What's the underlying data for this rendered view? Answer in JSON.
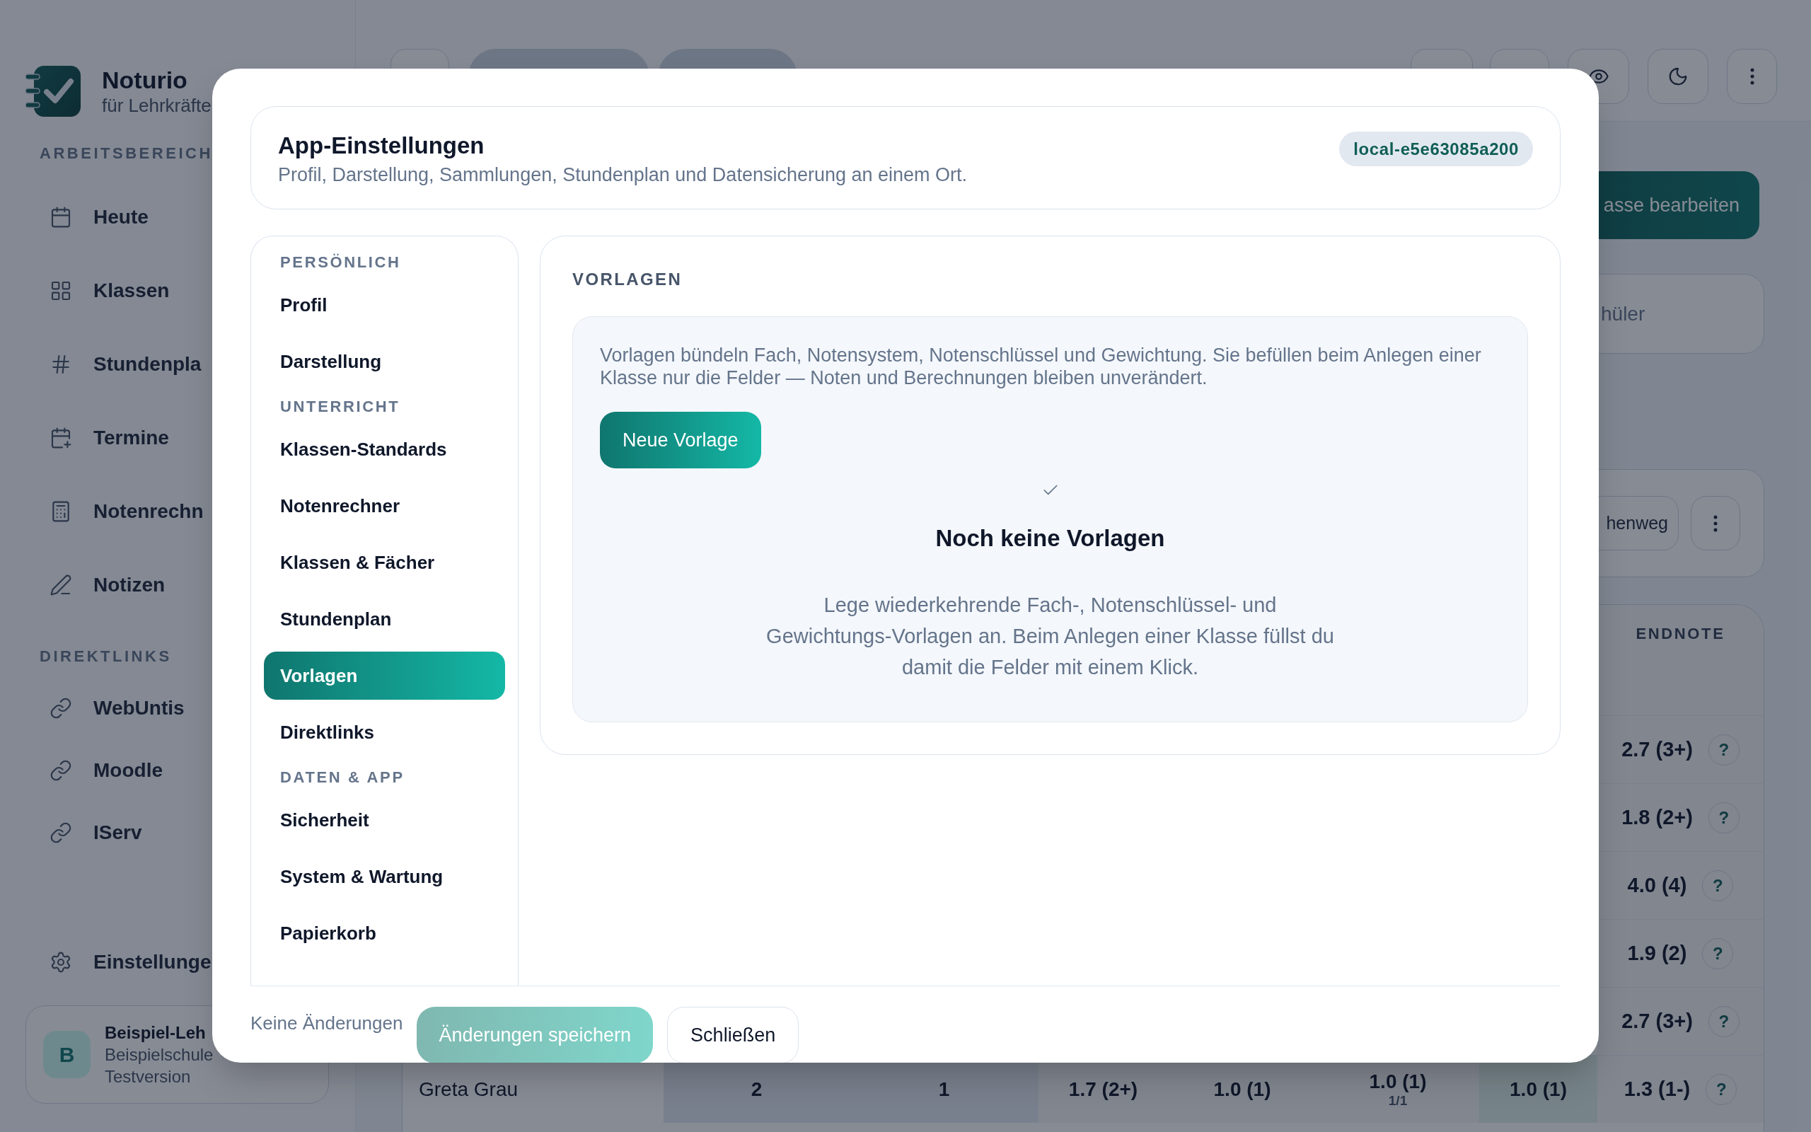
{
  "sidebar": {
    "brand": {
      "name": "Noturio",
      "subtitle": "für Lehrkräfte"
    },
    "sections": [
      {
        "label": "ARBEITSBEREICH",
        "items": [
          "Heute",
          "Klassen",
          "Stundenpla",
          "Termine",
          "Notenrechn",
          "Notizen"
        ]
      },
      {
        "label": "DIREKTLINKS",
        "items": [
          "WebUntis",
          "Moodle",
          "IServ"
        ]
      }
    ],
    "settings": "Einstellunge",
    "profile": {
      "avatar": "B",
      "name": "Beispiel-Leh",
      "school": "Beispielschule",
      "plan": "Testversion"
    }
  },
  "main": {
    "action_button": "asse bearbeiten",
    "partial_card": "hüler",
    "toolbar_button": "henweg",
    "table": {
      "endnote_header": "ENDNOTE",
      "rows": [
        {
          "endnote": "2.7 (3+)",
          "help": "?"
        },
        {
          "endnote": "1.8 (2+)",
          "help": "?"
        },
        {
          "endnote": "4.0 (4)",
          "help": "?"
        },
        {
          "endnote": "1.9 (2)",
          "help": "?"
        },
        {
          "endnote": "2.7 (3+)",
          "help": "?"
        },
        {
          "name": "Greta Grau",
          "cells": [
            {
              "value": "2"
            },
            {
              "value": "1"
            },
            {
              "value": "1.7 (2+)"
            },
            {
              "value": "1.0 (1)"
            },
            {
              "value": "1.0 (1)",
              "sub": "1/1"
            },
            {
              "value": "1.0 (1)"
            }
          ],
          "endnote": "1.3 (1-)",
          "help": "?"
        }
      ]
    }
  },
  "dialog": {
    "title": "App-Einstellungen",
    "subtitle": "Profil, Darstellung, Sammlungen, Stundenplan und Datensicherung an einem Ort.",
    "badge": "local-e5e63085a200",
    "nav": [
      {
        "label": "PERSÖNLICH",
        "items": [
          {
            "label": "Profil",
            "selected": false
          },
          {
            "label": "Darstellung",
            "selected": false
          }
        ]
      },
      {
        "label": "UNTERRICHT",
        "items": [
          {
            "label": "Klassen-Standards",
            "selected": false
          },
          {
            "label": "Notenrechner",
            "selected": false
          },
          {
            "label": "Klassen & Fächer",
            "selected": false
          },
          {
            "label": "Stundenplan",
            "selected": false
          },
          {
            "label": "Vorlagen",
            "selected": true
          },
          {
            "label": "Direktlinks",
            "selected": false
          }
        ]
      },
      {
        "label": "DATEN & APP",
        "items": [
          {
            "label": "Sicherheit",
            "selected": false
          },
          {
            "label": "System & Wartung",
            "selected": false
          },
          {
            "label": "Papierkorb",
            "selected": false
          }
        ]
      }
    ],
    "panel": {
      "heading": "VORLAGEN",
      "description": "Vorlagen bündeln Fach, Notensystem, Notenschlüssel und Gewichtung. Sie befüllen beim Anlegen einer Klasse nur die Felder — Noten und Berechnungen bleiben unverändert.",
      "new_button": "Neue Vorlage",
      "empty_title": "Noch keine Vorlagen",
      "empty_text": "Lege wiederkehrende Fach-, Notenschlüssel- und Gewichtungs-Vorlagen an. Beim Anlegen einer Klasse füllst du damit die Felder mit einem Klick."
    },
    "footer": {
      "status": "Keine Änderungen",
      "save": {
        "label": "Änderungen speichern",
        "disabled": true
      },
      "close": "Schließen"
    }
  }
}
